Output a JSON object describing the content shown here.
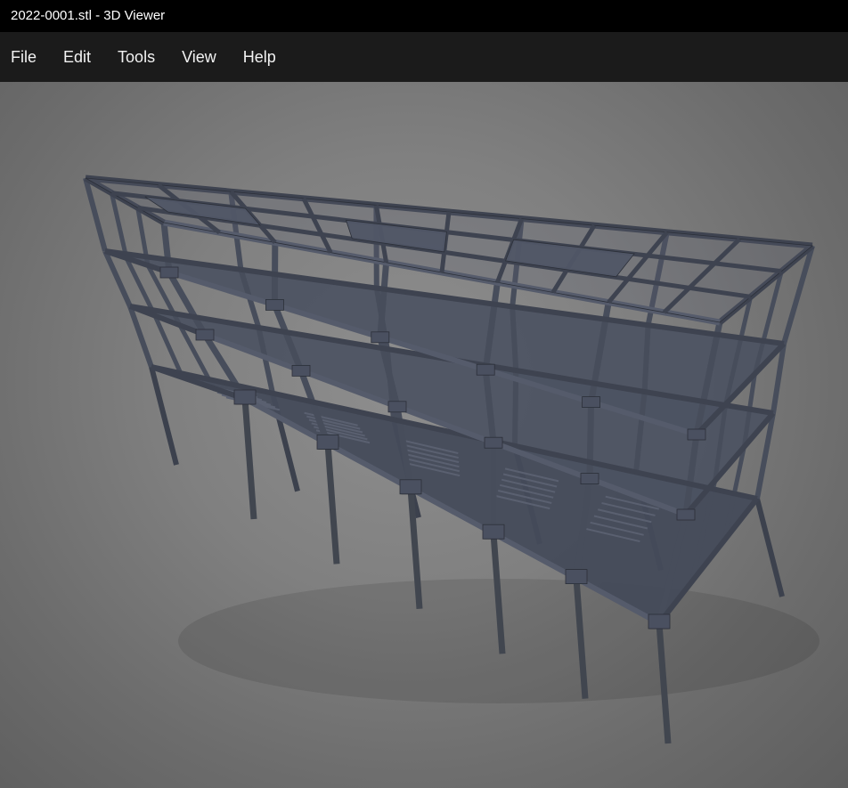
{
  "window": {
    "title": "2022-0001.stl - 3D Viewer"
  },
  "menubar": {
    "items": [
      {
        "label": "File"
      },
      {
        "label": "Edit"
      },
      {
        "label": "Tools"
      },
      {
        "label": "View"
      },
      {
        "label": "Help"
      }
    ]
  },
  "viewport": {
    "model_description": "structural-frame-model",
    "model_color": "#3f4450",
    "background_color": "#808080"
  }
}
